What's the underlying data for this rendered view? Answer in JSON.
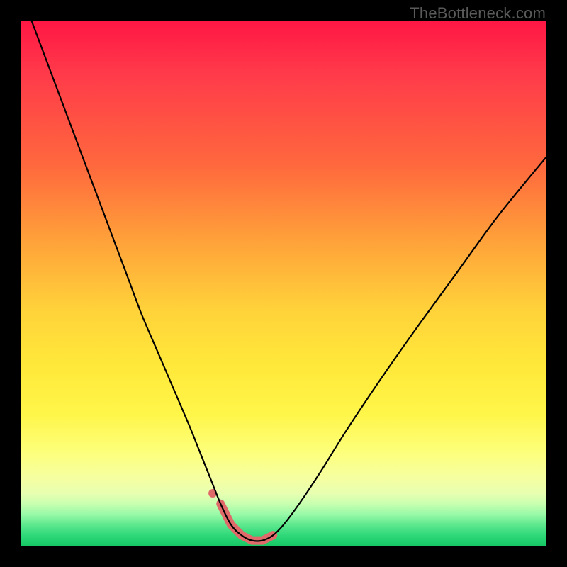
{
  "watermark": "TheBottleneck.com",
  "colors": {
    "frame": "#000000",
    "watermark_text": "#5a5a5a",
    "gradient_top": "#ff1744",
    "gradient_mid": "#ffe93a",
    "gradient_bottom": "#16c864",
    "curve": "#000000",
    "accent": "#e06a6a"
  },
  "chart_data": {
    "type": "line",
    "title": "",
    "xlabel": "",
    "ylabel": "",
    "xlim": [
      0,
      100
    ],
    "ylim": [
      0,
      100
    ],
    "grid": false,
    "legend": false,
    "annotations": [
      {
        "kind": "valley-highlight",
        "x_range": [
          38,
          48
        ],
        "y_approx": 2
      }
    ],
    "series": [
      {
        "name": "curve",
        "x": [
          2,
          5,
          8,
          11,
          14,
          17,
          20,
          23,
          26,
          29,
          32,
          34,
          36,
          38,
          40,
          42,
          44,
          46,
          48,
          50,
          53,
          57,
          62,
          68,
          75,
          83,
          91,
          100
        ],
        "y": [
          100,
          92,
          84,
          76,
          68,
          60,
          52,
          44,
          37,
          30,
          23,
          18,
          13,
          8,
          4,
          2,
          1,
          1,
          2,
          4,
          8,
          14,
          22,
          31,
          41,
          52,
          63,
          74
        ]
      }
    ]
  }
}
